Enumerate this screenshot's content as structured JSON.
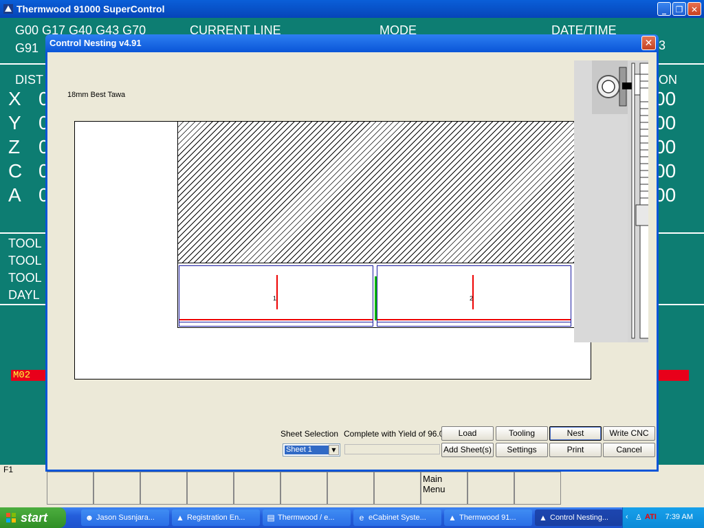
{
  "bg_window": {
    "title": "Thermwood 91000 SuperControl",
    "gcode_line1": "G00 G17 G40 G43 G70",
    "gcode_line2": "G91",
    "header_current_line": "CURRENT LINE",
    "header_mode": "MODE",
    "header_datetime": "DATE/TIME",
    "header_right_partial": "3",
    "dist_label": "DIST",
    "position_label_partial": "ON",
    "axes": [
      {
        "axis": "X",
        "val_left": "0",
        "val_right": "00"
      },
      {
        "axis": "Y",
        "val_left": "0",
        "val_right": "00"
      },
      {
        "axis": "Z",
        "val_left": "0",
        "val_right": "00"
      },
      {
        "axis": "C",
        "val_left": "0",
        "val_right": "00"
      },
      {
        "axis": "A",
        "val_left": "0",
        "val_right": "00"
      }
    ],
    "side_labels": [
      "TOOL",
      "TOOL",
      "TOOL",
      "DAYL"
    ],
    "status_code": "M02",
    "fkey_label": "F1",
    "fkey_main_menu_line1": "Main",
    "fkey_main_menu_line2": "Menu"
  },
  "dialog": {
    "title": "Control Nesting v4.91",
    "close_glyph": "✕",
    "sheet_material": "18mm Best Tawa",
    "parts": [
      {
        "number": "1"
      },
      {
        "number": "2"
      }
    ],
    "sheet_selection_label": "Sheet Selection",
    "sheet_selected": "Sheet 1",
    "status_text": "Complete with Yield of 96.0%",
    "progress_fraction": 0,
    "buttons": {
      "load": "Load",
      "tooling": "Tooling",
      "nest": "Nest",
      "write_cnc": "Write CNC",
      "add_sheets": "Add Sheet(s)",
      "settings": "Settings",
      "print": "Print",
      "cancel": "Cancel"
    }
  },
  "taskbar": {
    "start": "start",
    "tasks": [
      {
        "label": "Jason Susnjara...",
        "icon": "messenger-icon"
      },
      {
        "label": "Registration En...",
        "icon": "thermwood-icon"
      },
      {
        "label": "Thermwood / e...",
        "icon": "document-icon"
      },
      {
        "label": "eCabinet Syste...",
        "icon": "ie-icon"
      },
      {
        "label": "Thermwood 91...",
        "icon": "thermwood-icon"
      },
      {
        "label": "Control Nesting...",
        "icon": "thermwood-icon"
      }
    ],
    "tray_ati": "ATI",
    "clock": "7:39 AM"
  }
}
